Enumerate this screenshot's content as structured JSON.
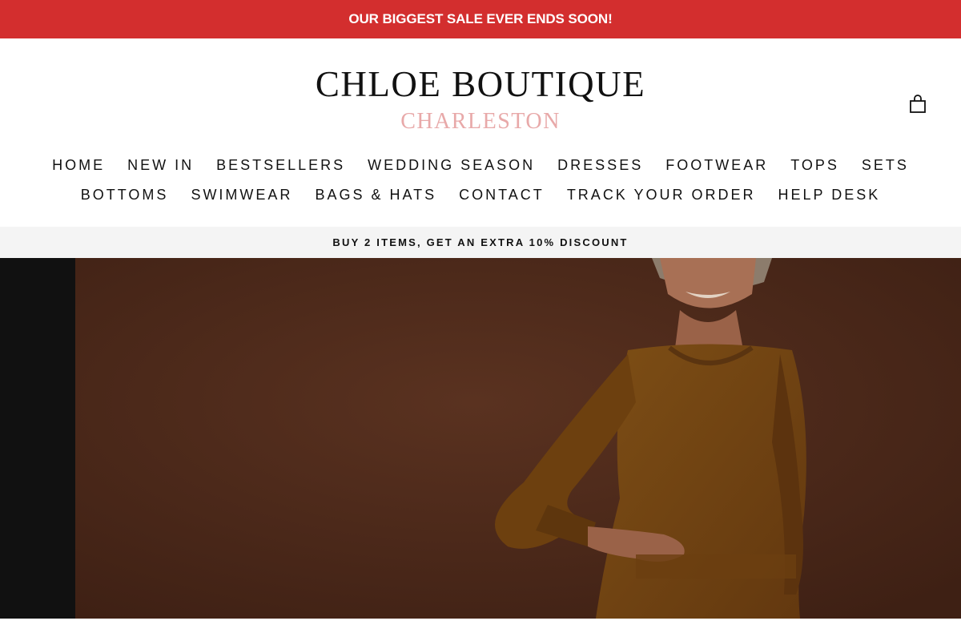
{
  "announcement": {
    "text": "OUR BIGGEST SALE EVER ENDS SOON!"
  },
  "logo": {
    "main": "CHLOE BOUTIQUE",
    "sub": "CHARLESTON"
  },
  "cart": {
    "icon": "shopping-bag-icon"
  },
  "nav": {
    "row1": [
      "HOME",
      "NEW IN",
      "BESTSELLERS",
      "WEDDING SEASON",
      "DRESSES",
      "FOOTWEAR",
      "TOPS",
      "SETS"
    ],
    "row2": [
      "BOTTOMS",
      "SWIMWEAR",
      "BAGS & HATS",
      "CONTACT",
      "TRACK YOUR ORDER",
      "HELP DESK"
    ]
  },
  "promo": {
    "text": "BUY 2 ITEMS, GET AN EXTRA 10% DISCOUNT"
  },
  "colors": {
    "announcement_bg": "#d32e2e",
    "logo_sub": "#e8a9a9",
    "promo_bg": "#f4f4f4",
    "hero_bg": "#4a2818",
    "sweater": "#7a4a14"
  }
}
